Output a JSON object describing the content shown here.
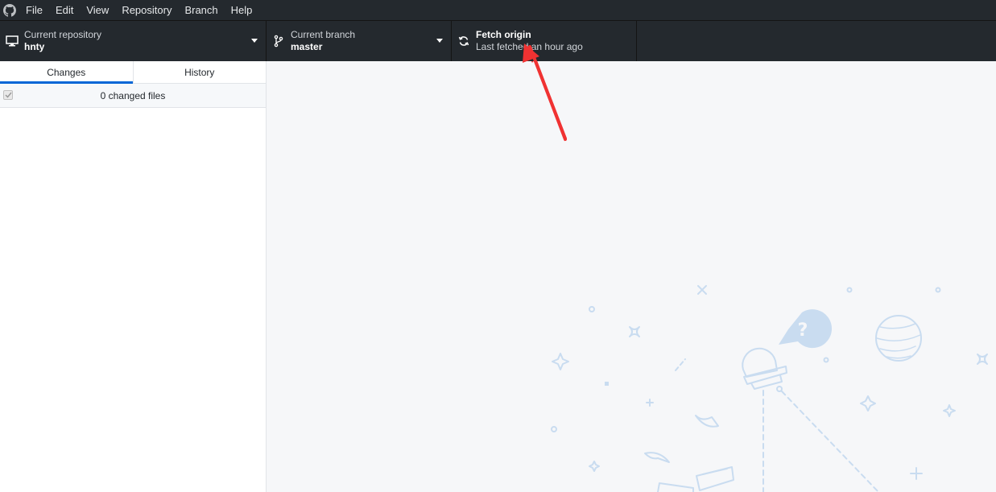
{
  "menubar": {
    "logo_icon": "github-octocat-icon",
    "items": [
      "File",
      "Edit",
      "View",
      "Repository",
      "Branch",
      "Help"
    ]
  },
  "toolbar": {
    "repository": {
      "label": "Current repository",
      "value": "hnty",
      "icon": "desktop-icon"
    },
    "branch": {
      "label": "Current branch",
      "value": "master",
      "icon": "git-branch-icon"
    },
    "fetch": {
      "title": "Fetch origin",
      "subtitle": "Last fetched an hour ago",
      "icon": "sync-icon"
    }
  },
  "sidebar": {
    "tabs": [
      {
        "label": "Changes",
        "active": true
      },
      {
        "label": "History",
        "active": false
      }
    ],
    "changes_summary": "0 changed files"
  },
  "colors": {
    "toolbar_bg": "#24292e",
    "accent_blue": "#0366d6",
    "annotation_red": "#f03232",
    "illustration_blue": "#c9dcf0"
  }
}
